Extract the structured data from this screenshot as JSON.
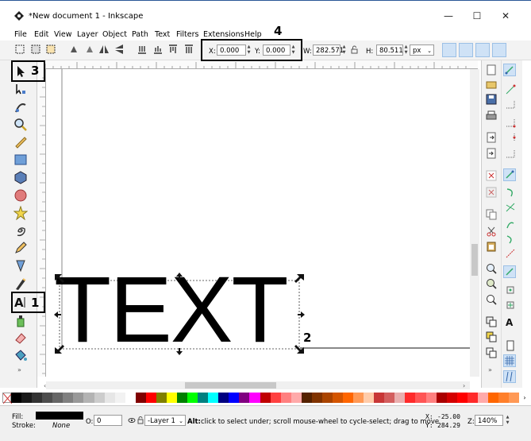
{
  "window": {
    "title": "*New document 1 - Inkscape",
    "minimize_glyph": "—",
    "maximize_glyph": "☐",
    "close_glyph": "✕"
  },
  "menu": [
    {
      "label": "File"
    },
    {
      "label": "Edit"
    },
    {
      "label": "View"
    },
    {
      "label": "Layer"
    },
    {
      "label": "Object"
    },
    {
      "label": "Path"
    },
    {
      "label": "Text"
    },
    {
      "label": "Filters"
    },
    {
      "label": "Extensions"
    },
    {
      "label": "Help"
    }
  ],
  "toolbar": {
    "x_label": "X:",
    "x_value": "0.000",
    "y_label": "Y:",
    "y_value": "0.000",
    "w_label": "W:",
    "w_value": "282.571",
    "h_label": "H:",
    "h_value": "80.511",
    "unit": "px"
  },
  "canvas": {
    "text_object": "TEXT"
  },
  "annotations": {
    "label_1": "1",
    "label_2": "2",
    "label_3": "3",
    "label_4": "4"
  },
  "palette": [
    "#000000",
    "#1a1a1a",
    "#333333",
    "#4d4d4d",
    "#666666",
    "#808080",
    "#999999",
    "#b3b3b3",
    "#cccccc",
    "#e6e6e6",
    "#f2f2f2",
    "#ffffff",
    "#800000",
    "#ff0000",
    "#808000",
    "#ffff00",
    "#008000",
    "#00ff00",
    "#008080",
    "#00ffff",
    "#000080",
    "#0000ff",
    "#800080",
    "#ff00ff",
    "#c00000",
    "#ff4040",
    "#ff8080",
    "#ffaaaa",
    "#552200",
    "#803300",
    "#aa4400",
    "#d45500",
    "#ff6600",
    "#ff9955",
    "#ffccaa",
    "#c83737",
    "#d35f5f",
    "#e9afaf",
    "#ff2a2a",
    "#ff5555",
    "#ff8080",
    "#aa0000",
    "#d40000",
    "#ff0000",
    "#ff2a2a",
    "#ffaaaa",
    "#ff6600",
    "#ff7f2a",
    "#ff9955"
  ],
  "status": {
    "fill_label": "Fill:",
    "stroke_label": "Stroke:",
    "stroke_value": "None",
    "opacity_label": "O:",
    "opacity_value": "0",
    "layer": "-Layer 1",
    "message_bold": "Alt:",
    "message": "click to select under; scroll mouse-wheel to cycle-select; drag to move",
    "x_label": "X:",
    "x_value": "-25.00",
    "y_label": "Y:",
    "y_value": "284.29",
    "zoom_label": "Z:",
    "zoom_value": "140%"
  }
}
